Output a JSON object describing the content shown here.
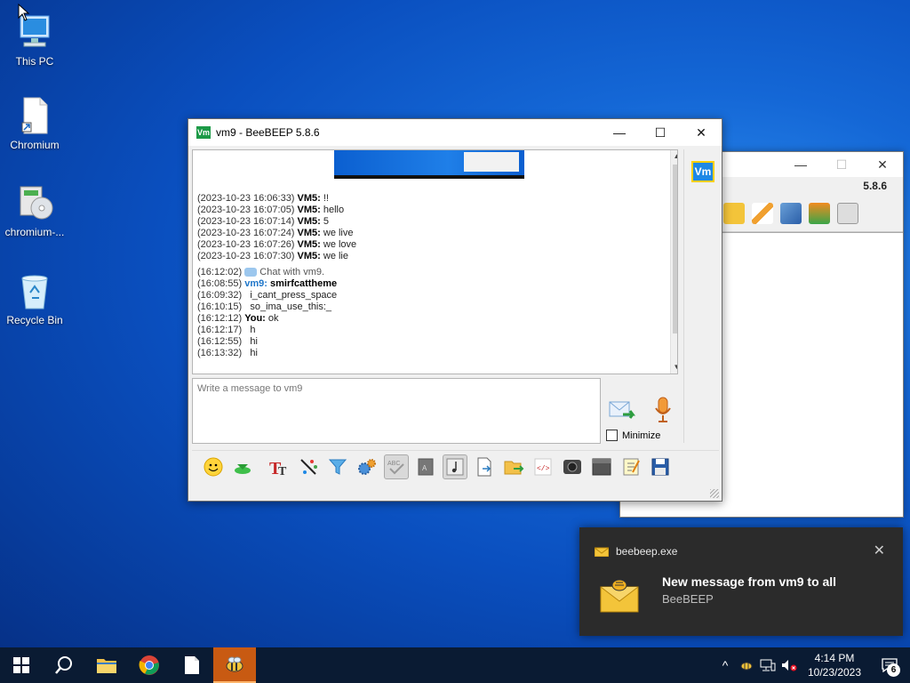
{
  "desktop": {
    "icons": [
      {
        "label": "This PC"
      },
      {
        "label": "Chromium"
      },
      {
        "label": "chromium-..."
      },
      {
        "label": "Recycle Bin"
      }
    ]
  },
  "back_window": {
    "version": "5.8.6",
    "controls": {
      "min": "—",
      "max": "☐",
      "close": "✕"
    }
  },
  "main_window": {
    "app_badge": "Vm",
    "title": "vm9 - BeeBEEP 5.8.6",
    "controls": {
      "min": "—",
      "max": "☐",
      "close": "✕"
    },
    "chat": [
      {
        "ts": "(2023-10-23 16:06:33)",
        "who": "VM5:",
        "msg": " !!"
      },
      {
        "ts": "(2023-10-23 16:07:05)",
        "who": "VM5:",
        "msg": " hello"
      },
      {
        "ts": "(2023-10-23 16:07:14)",
        "who": "VM5:",
        "msg": " 5"
      },
      {
        "ts": "(2023-10-23 16:07:24)",
        "who": "VM5:",
        "msg": " we live"
      },
      {
        "ts": "(2023-10-23 16:07:26)",
        "who": "VM5:",
        "msg": " we love"
      },
      {
        "ts": "(2023-10-23 16:07:30)",
        "who": "VM5:",
        "msg": " we lie"
      }
    ],
    "chat_with": {
      "ts": "(16:12:02)",
      "text": "Chat with vm9."
    },
    "chat2": [
      {
        "ts": "(16:08:55)",
        "who": "vm9:",
        "msg": "smirfcattheme"
      },
      {
        "ts": "(16:09:32)",
        "msg": "i_cant_press_space"
      },
      {
        "ts": "(16:10:15)",
        "msg": "so_ima_use_this:_"
      },
      {
        "ts": "(16:12:12)",
        "who": "You:",
        "msg": " ok"
      },
      {
        "ts": "(16:12:17)",
        "msg": "h"
      },
      {
        "ts": "(16:12:55)",
        "msg": "hi"
      },
      {
        "ts": "(16:13:32)",
        "msg": "hi"
      }
    ],
    "input_placeholder": "Write a message to vm9",
    "minimize_label": "Minimize",
    "side_badge": "Vm"
  },
  "toast": {
    "app": "beebeep.exe",
    "headline": "New message from vm9 to all",
    "sub": "BeeBEEP",
    "close": "✕"
  },
  "taskbar": {
    "time": "4:14 PM",
    "date": "10/23/2023",
    "notif_count": "6",
    "tray_caret": "^"
  },
  "colors": {
    "accent": "#1e88e5",
    "taskbar": "#0a1b33",
    "active_task": "#c85a12"
  }
}
